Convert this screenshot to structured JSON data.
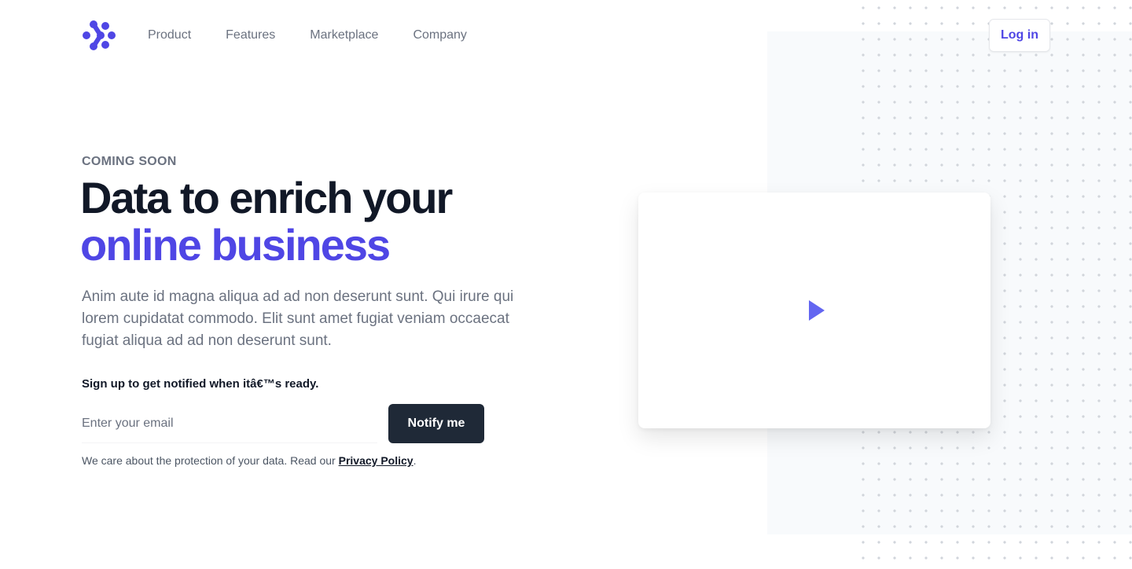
{
  "colors": {
    "brand": "#4f46e5",
    "heading": "#111827",
    "muted": "#6b7280",
    "button_dark": "#1f2937",
    "panel_bg": "#f8fafc",
    "dots": "#d1d5db"
  },
  "header": {
    "logo_icon": "brand-logo-icon",
    "nav": [
      {
        "label": "Product"
      },
      {
        "label": "Features"
      },
      {
        "label": "Marketplace"
      },
      {
        "label": "Company"
      }
    ],
    "login_label": "Log in"
  },
  "hero": {
    "eyebrow": "COMING SOON",
    "title_line1": "Data to enrich your",
    "title_line2": "online business",
    "lead": "Anim aute id magna aliqua ad ad non deserunt sunt. Qui irure qui lorem cupidatat commodo. Elit sunt amet fugiat veniam occaecat fugiat aliqua ad ad non deserunt sunt.",
    "signup_note": "Sign up to get notified when itâ€™s ready.",
    "email_placeholder": "Enter your email",
    "email_value": "",
    "notify_label": "Notify me",
    "privacy_text": "We care about the protection of your data. Read our ",
    "privacy_link": "Privacy Policy",
    "privacy_suffix": "."
  },
  "video": {
    "play_icon": "play-icon"
  }
}
